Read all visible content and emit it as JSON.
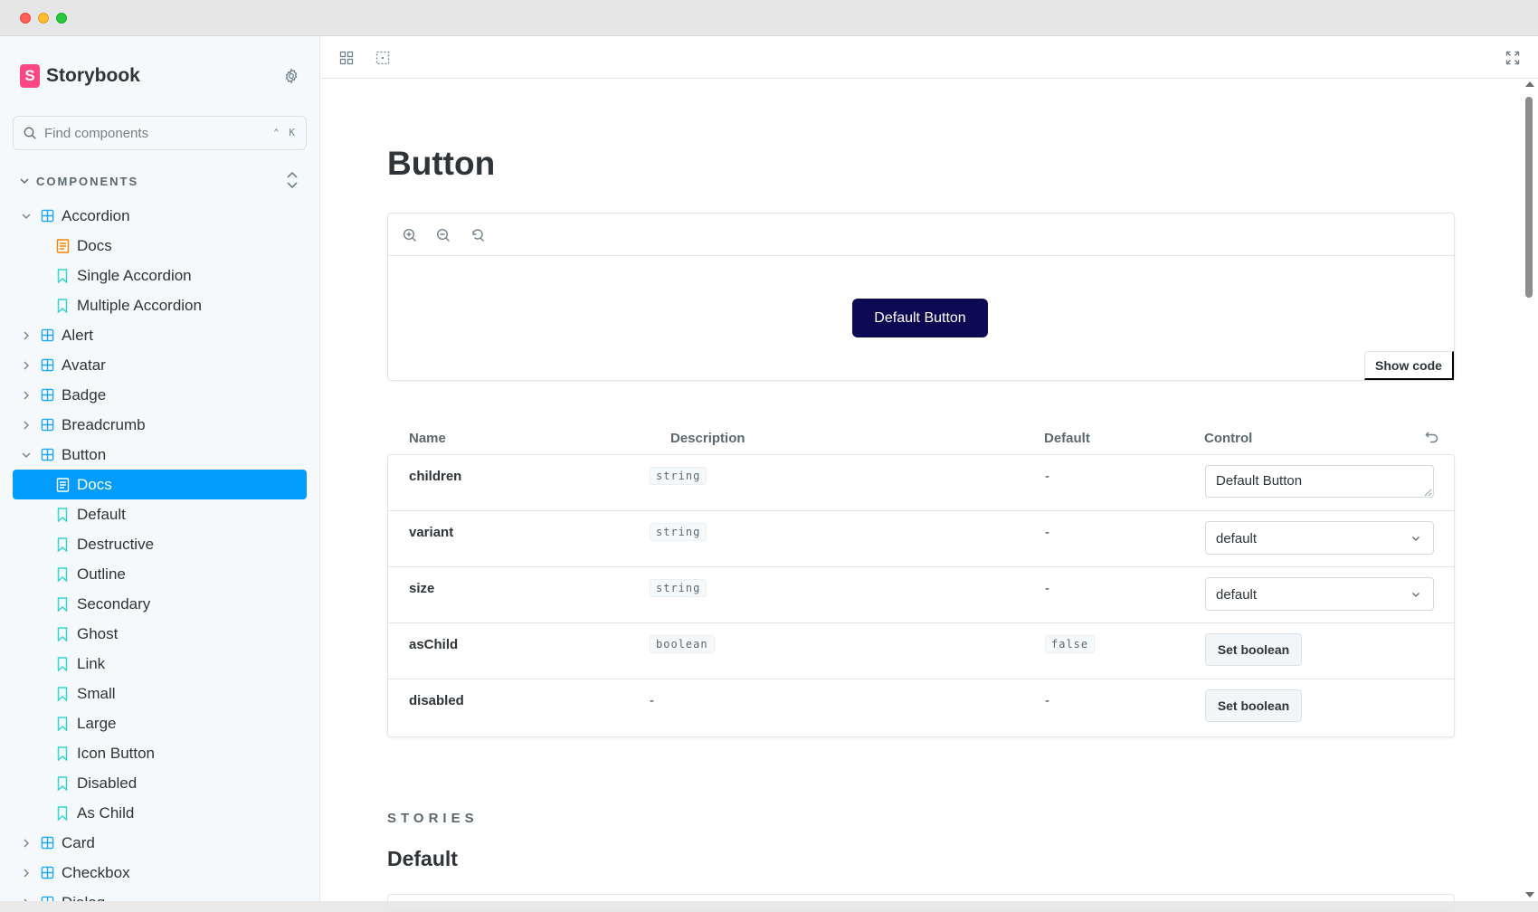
{
  "sidebar": {
    "brand": "Storybook",
    "search": {
      "placeholder": "Find components",
      "shortcut": "⌃ K"
    },
    "section": "COMPONENTS",
    "items": [
      {
        "label": "Accordion",
        "level": 0,
        "kind": "component",
        "expanded": true
      },
      {
        "label": "Docs",
        "level": 1,
        "kind": "docs"
      },
      {
        "label": "Single Accordion",
        "level": 1,
        "kind": "story"
      },
      {
        "label": "Multiple Accordion",
        "level": 1,
        "kind": "story"
      },
      {
        "label": "Alert",
        "level": 0,
        "kind": "component",
        "expanded": false
      },
      {
        "label": "Avatar",
        "level": 0,
        "kind": "component",
        "expanded": false
      },
      {
        "label": "Badge",
        "level": 0,
        "kind": "component",
        "expanded": false
      },
      {
        "label": "Breadcrumb",
        "level": 0,
        "kind": "component",
        "expanded": false
      },
      {
        "label": "Button",
        "level": 0,
        "kind": "component",
        "expanded": true
      },
      {
        "label": "Docs",
        "level": 1,
        "kind": "docs",
        "selected": true
      },
      {
        "label": "Default",
        "level": 1,
        "kind": "story"
      },
      {
        "label": "Destructive",
        "level": 1,
        "kind": "story"
      },
      {
        "label": "Outline",
        "level": 1,
        "kind": "story"
      },
      {
        "label": "Secondary",
        "level": 1,
        "kind": "story"
      },
      {
        "label": "Ghost",
        "level": 1,
        "kind": "story"
      },
      {
        "label": "Link",
        "level": 1,
        "kind": "story"
      },
      {
        "label": "Small",
        "level": 1,
        "kind": "story"
      },
      {
        "label": "Large",
        "level": 1,
        "kind": "story"
      },
      {
        "label": "Icon Button",
        "level": 1,
        "kind": "story"
      },
      {
        "label": "Disabled",
        "level": 1,
        "kind": "story"
      },
      {
        "label": "As Child",
        "level": 1,
        "kind": "story"
      },
      {
        "label": "Card",
        "level": 0,
        "kind": "component",
        "expanded": false
      },
      {
        "label": "Checkbox",
        "level": 0,
        "kind": "component",
        "expanded": false
      },
      {
        "label": "Dialog",
        "level": 0,
        "kind": "component",
        "expanded": false
      }
    ]
  },
  "toolbar": {
    "icons": [
      "grid-icon",
      "outline-icon",
      "fullscreen-icon"
    ]
  },
  "doc": {
    "title": "Button",
    "preview": {
      "zoom_icons": [
        "zoom-in-icon",
        "zoom-out-icon",
        "zoom-reset-icon"
      ],
      "button_label": "Default Button",
      "show_code": "Show code"
    },
    "argtable": {
      "headers": {
        "name": "Name",
        "description": "Description",
        "default": "Default",
        "control": "Control"
      },
      "rows": [
        {
          "name": "children",
          "type": "string",
          "default": "-",
          "control": "text",
          "value": "Default Button"
        },
        {
          "name": "variant",
          "type": "string",
          "default": "-",
          "control": "select",
          "value": "default"
        },
        {
          "name": "size",
          "type": "string",
          "default": "-",
          "control": "select",
          "value": "default"
        },
        {
          "name": "asChild",
          "type": "boolean",
          "default": "false",
          "control": "boolean",
          "value": "Set boolean"
        },
        {
          "name": "disabled",
          "type": "-",
          "default": "-",
          "control": "boolean",
          "value": "Set boolean"
        }
      ]
    },
    "stories_label": "STORIES",
    "first_story": "Default"
  },
  "colors": {
    "accent": "#029cfd",
    "brand": "#ff4785",
    "primary_button": "#0b0a52",
    "component_icon": "#1ea7fd",
    "docs_icon": "#ff8300",
    "story_icon": "#37d5d3"
  }
}
